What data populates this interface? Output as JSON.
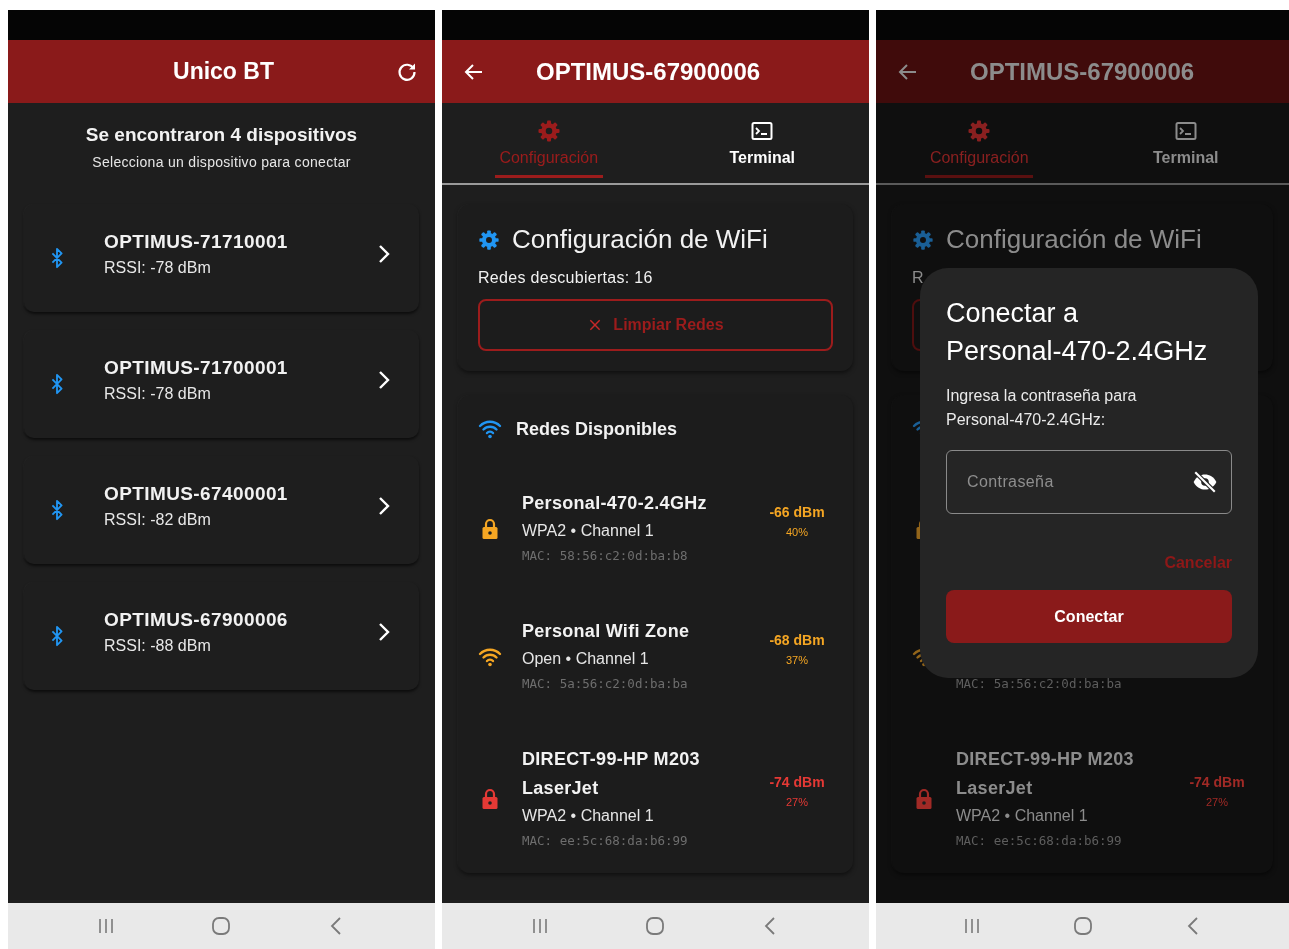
{
  "screens": [
    {
      "kind": "device_list",
      "header": {
        "title": "Unico BT"
      },
      "heading": "Se encontraron 4 dispositivos",
      "subheading": "Selecciona un dispositivo para conectar",
      "devices": [
        {
          "name": "OPTIMUS-71710001",
          "rssi": "RSSI: -78 dBm"
        },
        {
          "name": "OPTIMUS-71700001",
          "rssi": "RSSI: -78 dBm"
        },
        {
          "name": "OPTIMUS-67400001",
          "rssi": "RSSI: -82 dBm"
        },
        {
          "name": "OPTIMUS-67900006",
          "rssi": "RSSI: -88 dBm"
        }
      ]
    },
    {
      "kind": "wifi_config",
      "header": {
        "title": "OPTIMUS-67900006"
      },
      "tabs": [
        {
          "label": "Configuración",
          "selected": true
        },
        {
          "label": "Terminal",
          "selected": false
        }
      ],
      "wifi_card": {
        "title": "Configuración de WiFi",
        "subtitle": "Redes descubiertas: 16",
        "clear_button": "Limpiar Redes"
      },
      "networks_card": {
        "title": "Redes Disponibles",
        "networks": [
          {
            "kind": "lock",
            "name": "Personal-470-2.4GHz",
            "detail": "WPA2 • Channel 1",
            "mac": "MAC: 58:56:c2:0d:ba:b8",
            "signal": "-66 dBm",
            "percent": "40%",
            "color": "#f5a623"
          },
          {
            "kind": "wifi",
            "name": "Personal Wifi Zone",
            "detail": "Open • Channel 1",
            "mac": "MAC: 5a:56:c2:0d:ba:ba",
            "signal": "-68 dBm",
            "percent": "37%",
            "color": "#f5a623"
          },
          {
            "kind": "lock",
            "name": "DIRECT-99-HP M203 LaserJet",
            "detail": "WPA2 • Channel 1",
            "mac": "MAC: ee:5c:68:da:b6:99",
            "signal": "-74 dBm",
            "percent": "27%",
            "color": "#e53935"
          }
        ]
      }
    },
    {
      "kind": "wifi_config",
      "header": {
        "title": "OPTIMUS-67900006"
      },
      "tabs": [
        {
          "label": "Configuración",
          "selected": true
        },
        {
          "label": "Terminal",
          "selected": false
        }
      ],
      "wifi_card": {
        "title": "Configuración de WiFi",
        "subtitle": "R"
      },
      "networks_card": {
        "networks": [
          {
            "kind": "lock"
          },
          {
            "kind": "wifi",
            "mac": "MAC: 5a:56:c2:0d:ba:ba"
          },
          {
            "kind": "lock",
            "name": "DIRECT-99-HP M203 LaserJet",
            "detail": "WPA2 • Channel 1",
            "mac": "MAC: ee:5c:68:da:b6:99",
            "signal": "-74 dBm",
            "percent": "27%",
            "color": "#a12a26"
          }
        ]
      },
      "dialog": {
        "title": "Conectar a Personal-470-2.4GHz",
        "message": "Ingresa la contraseña para Personal-470-2.4GHz:",
        "field": {
          "placeholder": "Contraseña"
        },
        "cancel": "Cancelar",
        "confirm": "Conectar"
      }
    }
  ]
}
